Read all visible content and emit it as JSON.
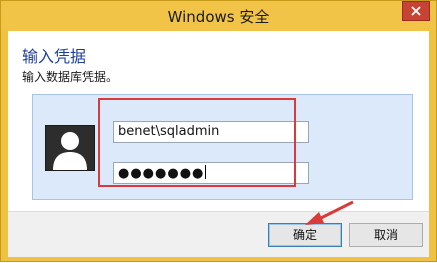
{
  "window": {
    "title": "Windows 安全"
  },
  "dialog": {
    "heading": "输入凭据",
    "subheading": "输入数据库凭据。",
    "username_value": "benet\\sqladmin",
    "password_mask": "●●●●●●●"
  },
  "buttons": {
    "ok_label": "确定",
    "cancel_label": "取消"
  },
  "colors": {
    "title_bar": "#f1c448",
    "heading": "#1e3f99",
    "panel": "#dce9fb",
    "annotation": "#d93a3a",
    "close_button": "#c64434"
  }
}
